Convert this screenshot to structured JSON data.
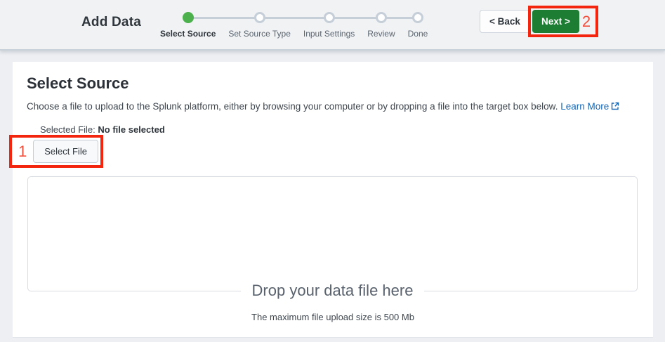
{
  "header": {
    "title": "Add Data",
    "steps": [
      {
        "label": "Select Source",
        "active": true
      },
      {
        "label": "Set Source Type",
        "active": false
      },
      {
        "label": "Input Settings",
        "active": false
      },
      {
        "label": "Review",
        "active": false
      },
      {
        "label": "Done",
        "active": false
      }
    ],
    "back_label": "< Back",
    "next_label": "Next >"
  },
  "annotations": {
    "select_file_number": "1",
    "next_number": "2"
  },
  "main": {
    "heading": "Select Source",
    "description": "Choose a file to upload to the Splunk platform, either by browsing your computer or by dropping a file into the target box below.",
    "learn_more_label": "Learn More",
    "selected_file_label": "Selected File:",
    "selected_file_value": "No file selected",
    "select_file_button": "Select File",
    "dropzone_label": "Drop your data file here",
    "dropzone_hint": "The maximum file upload size is 500 Mb"
  },
  "colors": {
    "active_step_green": "#4cb04c",
    "next_button_green": "#1d7d33",
    "link_blue": "#1167b8",
    "annotation_red": "#f3250e",
    "annotation_number_red": "#f0503c",
    "header_background": "#f0f2f4",
    "page_background": "#edeff2"
  }
}
